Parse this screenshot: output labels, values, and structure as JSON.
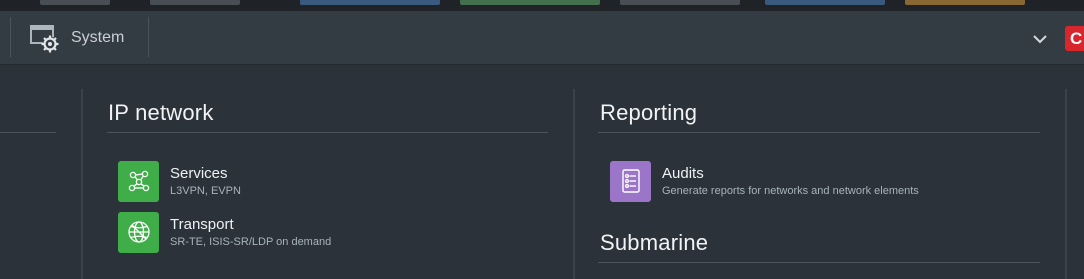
{
  "header": {
    "system_label": "System",
    "badge_letter": "C"
  },
  "sections": {
    "ip_network": {
      "title": "IP network",
      "items": [
        {
          "title": "Services",
          "subtitle": "L3VPN, EVPN"
        },
        {
          "title": "Transport",
          "subtitle": "SR-TE, ISIS-SR/LDP on demand"
        }
      ]
    },
    "reporting": {
      "title": "Reporting",
      "items": [
        {
          "title": "Audits",
          "subtitle": "Generate reports for networks and network elements"
        }
      ]
    },
    "submarine": {
      "title": "Submarine"
    }
  },
  "colors": {
    "header_bg": "#333b43",
    "panel_bg": "#2b323a",
    "green_tile": "#3fae49",
    "purple_tile": "#9b76c8",
    "badge_red": "#d9262c"
  },
  "icons": {
    "system": "gear-monitor-icon",
    "chevron": "chevron-down-icon",
    "services": "network-nodes-icon",
    "transport": "globe-mesh-icon",
    "audits": "report-document-icon"
  }
}
